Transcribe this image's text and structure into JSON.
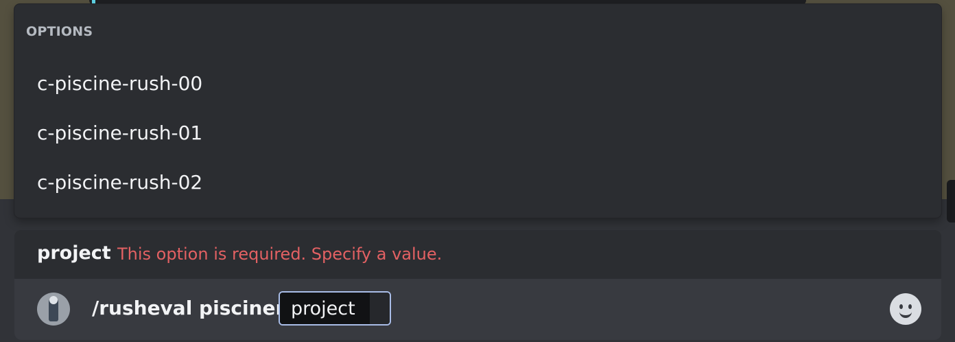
{
  "options_popup": {
    "header": "OPTIONS",
    "items": [
      {
        "label": "c-piscine-rush-00"
      },
      {
        "label": "c-piscine-rush-01"
      },
      {
        "label": "c-piscine-rush-02"
      }
    ]
  },
  "composer": {
    "hint": {
      "option_name": "project",
      "error": "This option is required. Specify a value."
    },
    "command": "/rusheval pisciners",
    "param_label": "project",
    "emoji_button_icon": "smiley-face-icon",
    "avatar_icon": "user-avatar-icon"
  },
  "colors": {
    "error": "#e36163",
    "popup_bg": "#2b2d31",
    "input_bg": "#383a40",
    "param_border": "#a9bde8"
  }
}
